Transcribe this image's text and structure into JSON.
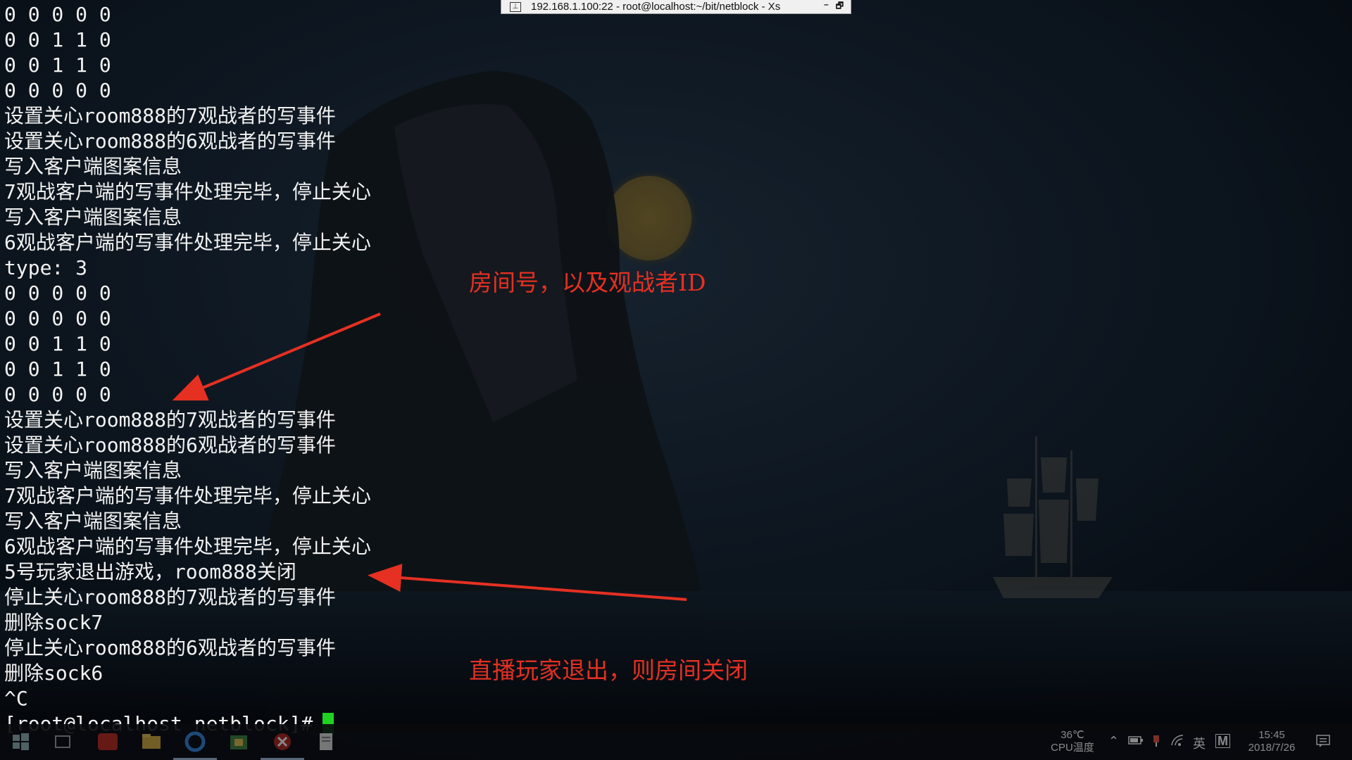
{
  "window": {
    "title": "192.168.1.100:22 - root@localhost:~/bit/netblock - Xs",
    "pin_glyph": "⊥",
    "minimize_glyph": "–",
    "restore_glyph": "🗗"
  },
  "terminal": {
    "lines": [
      "0 0 0 0 0",
      "0 0 1 1 0",
      "0 0 1 1 0",
      "0 0 0 0 0",
      "设置关心room888的7观战者的写事件",
      "设置关心room888的6观战者的写事件",
      "写入客户端图案信息",
      "7观战客户端的写事件处理完毕，停止关心",
      "写入客户端图案信息",
      "6观战客户端的写事件处理完毕，停止关心",
      "type: 3",
      "0 0 0 0 0",
      "0 0 0 0 0",
      "0 0 1 1 0",
      "0 0 1 1 0",
      "0 0 0 0 0",
      "设置关心room888的7观战者的写事件",
      "设置关心room888的6观战者的写事件",
      "写入客户端图案信息",
      "7观战客户端的写事件处理完毕，停止关心",
      "写入客户端图案信息",
      "6观战客户端的写事件处理完毕，停止关心",
      "5号玩家退出游戏，room888关闭",
      "停止关心room888的7观战者的写事件",
      "删除sock7",
      "停止关心room888的6观战者的写事件",
      "删除sock6",
      "^C"
    ],
    "prompt": "[root@localhost netblock]#"
  },
  "annotations": {
    "room_id_note": "房间号，以及观战者ID",
    "exit_note": "直播玩家退出，则房间关闭",
    "color": "#e53022"
  },
  "taskbar": {
    "icons": [
      "windows-start-icon",
      "task-view-icon",
      "youdao-icon",
      "file-explorer-icon",
      "edge-icon",
      "store-icon",
      "xshell-icon",
      "notepad-icon"
    ],
    "cpu_temp": "36℃",
    "cpu_label": "CPU温度",
    "ime_label": "英",
    "ime_mode": "M",
    "time": "15:45",
    "date": "2018/7/26"
  },
  "colors": {
    "terminal_text": "#f2f2f2",
    "cursor": "#1fd31f",
    "background": "#050a12"
  }
}
